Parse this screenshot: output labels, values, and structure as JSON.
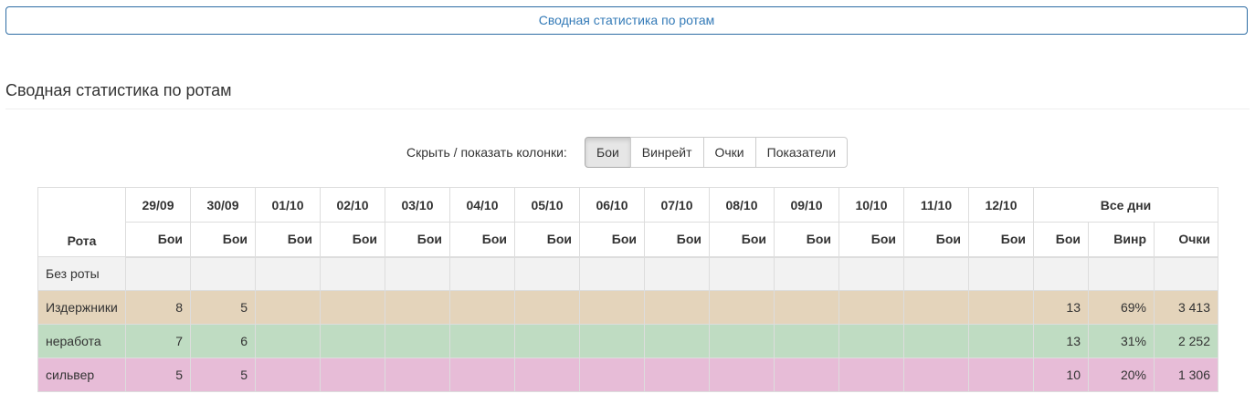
{
  "top_button": {
    "label": "Сводная статистика по ротам"
  },
  "section": {
    "title": "Сводная статистика по ротам"
  },
  "column_toggle": {
    "label": "Скрыть / показать колонки:",
    "buttons": [
      {
        "label": "Бои",
        "active": true
      },
      {
        "label": "Винрейт",
        "active": false
      },
      {
        "label": "Очки",
        "active": false
      },
      {
        "label": "Показатели",
        "active": false
      }
    ]
  },
  "table": {
    "rota_header": "Рота",
    "dates": [
      "29/09",
      "30/09",
      "01/10",
      "02/10",
      "03/10",
      "04/10",
      "05/10",
      "06/10",
      "07/10",
      "08/10",
      "09/10",
      "10/10",
      "11/10",
      "12/10"
    ],
    "battles_sub": "Бои",
    "all_days": {
      "label": "Все дни",
      "battles": "Бои",
      "winrate": "Винр",
      "points": "Очки"
    },
    "rows": [
      {
        "name": "Без роты",
        "color": "#f2f2f2",
        "days": [
          "",
          "",
          "",
          "",
          "",
          "",
          "",
          "",
          "",
          "",
          "",
          "",
          "",
          ""
        ],
        "total_battles": "",
        "winrate": "",
        "points": ""
      },
      {
        "name": "Издержники",
        "color": "#e4d4bb",
        "days": [
          "8",
          "5",
          "",
          "",
          "",
          "",
          "",
          "",
          "",
          "",
          "",
          "",
          "",
          ""
        ],
        "total_battles": "13",
        "winrate": "69%",
        "points": "3 413"
      },
      {
        "name": "неработа",
        "color": "#bfdcc2",
        "days": [
          "7",
          "6",
          "",
          "",
          "",
          "",
          "",
          "",
          "",
          "",
          "",
          "",
          "",
          ""
        ],
        "total_battles": "13",
        "winrate": "31%",
        "points": "2 252"
      },
      {
        "name": "сильвер",
        "color": "#e7bcd7",
        "days": [
          "5",
          "5",
          "",
          "",
          "",
          "",
          "",
          "",
          "",
          "",
          "",
          "",
          "",
          ""
        ],
        "total_battles": "10",
        "winrate": "20%",
        "points": "1 306"
      }
    ]
  }
}
